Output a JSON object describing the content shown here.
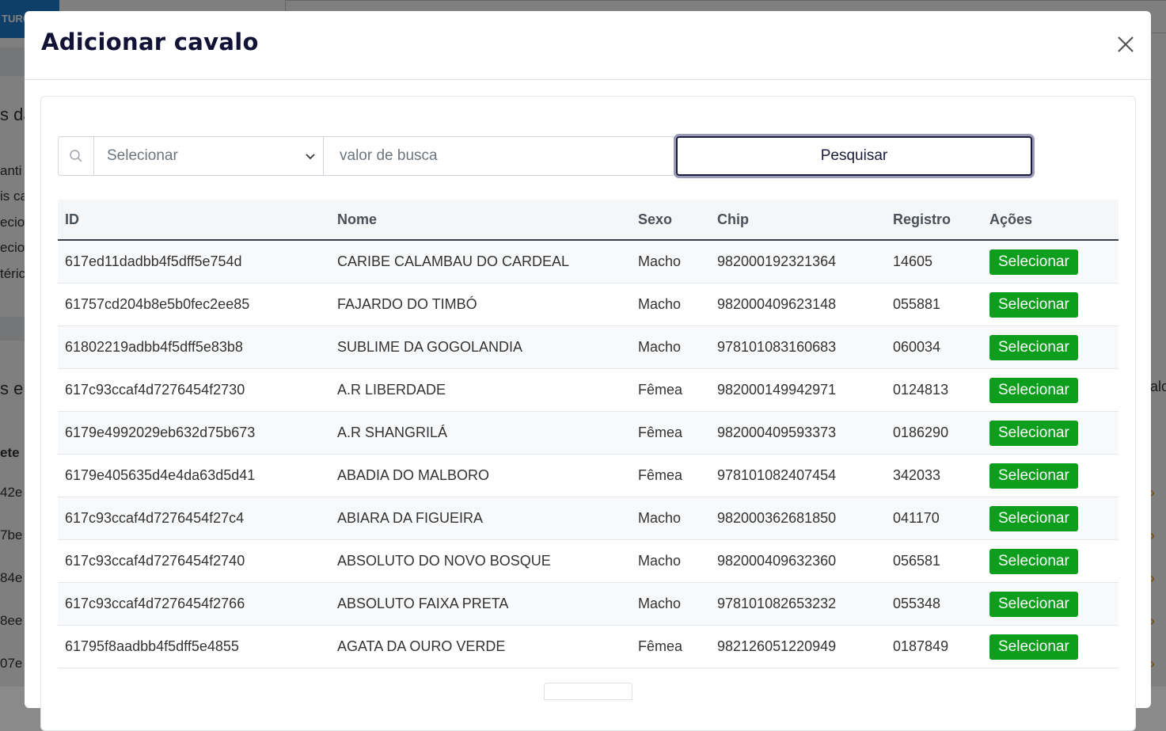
{
  "background": {
    "top_button": "TURO",
    "fragments": [
      "s da",
      "anti",
      "is ca",
      "ecio",
      "ecio",
      "téric",
      "s e",
      "ete",
      "42e",
      "7be",
      "84e",
      "8ee",
      "07e"
    ],
    "right_fragment": "alo"
  },
  "modal": {
    "title": "Adicionar cavalo",
    "close_label": "×"
  },
  "search": {
    "select_placeholder": "Selecionar",
    "input_placeholder": "valor de busca",
    "button_label": "Pesquisar"
  },
  "table": {
    "headers": {
      "id": "ID",
      "name": "Nome",
      "sex": "Sexo",
      "chip": "Chip",
      "registry": "Registro",
      "actions": "Ações"
    },
    "rows": [
      {
        "id": "617ed11dadbb4f5dff5e754d",
        "name": "CARIBE CALAMBAU DO CARDEAL",
        "sex": "Macho",
        "chip": "982000192321364",
        "registry": "14605",
        "action": "Selecionar"
      },
      {
        "id": "61757cd204b8e5b0fec2ee85",
        "name": "FAJARDO DO TIMBÓ",
        "sex": "Macho",
        "chip": "982000409623148",
        "registry": "055881",
        "action": "Selecionar"
      },
      {
        "id": "61802219adbb4f5dff5e83b8",
        "name": "SUBLIME DA GOGOLANDIA",
        "sex": "Macho",
        "chip": "978101083160683",
        "registry": "060034",
        "action": "Selecionar"
      },
      {
        "id": "617c93ccaf4d7276454f2730",
        "name": "A.R LIBERDADE",
        "sex": "Fêmea",
        "chip": "982000149942971",
        "registry": "0124813",
        "action": "Selecionar"
      },
      {
        "id": "6179e4992029eb632d75b673",
        "name": "A.R SHANGRILÁ",
        "sex": "Fêmea",
        "chip": "982000409593373",
        "registry": "0186290",
        "action": "Selecionar"
      },
      {
        "id": "6179e405635d4e4da63d5d41",
        "name": "ABADIA DO MALBORO",
        "sex": "Fêmea",
        "chip": "978101082407454",
        "registry": "342033",
        "action": "Selecionar"
      },
      {
        "id": "617c93ccaf4d7276454f27c4",
        "name": "ABIARA DA FIGUEIRA",
        "sex": "Macho",
        "chip": "982000362681850",
        "registry": "041170",
        "action": "Selecionar"
      },
      {
        "id": "617c93ccaf4d7276454f2740",
        "name": "ABSOLUTO DO NOVO BOSQUE",
        "sex": "Macho",
        "chip": "982000409632360",
        "registry": "056581",
        "action": "Selecionar"
      },
      {
        "id": "617c93ccaf4d7276454f2766",
        "name": "ABSOLUTO FAIXA PRETA",
        "sex": "Macho",
        "chip": "978101082653232",
        "registry": "055348",
        "action": "Selecionar"
      },
      {
        "id": "61795f8aadbb4f5dff5e4855",
        "name": "AGATA DA OURO VERDE",
        "sex": "Fêmea",
        "chip": "982126051220949",
        "registry": "0187849",
        "action": "Selecionar"
      }
    ]
  },
  "colors": {
    "select_button": "#0d9e1d",
    "title": "#121236",
    "search_button_border": "#1b1b3a"
  }
}
